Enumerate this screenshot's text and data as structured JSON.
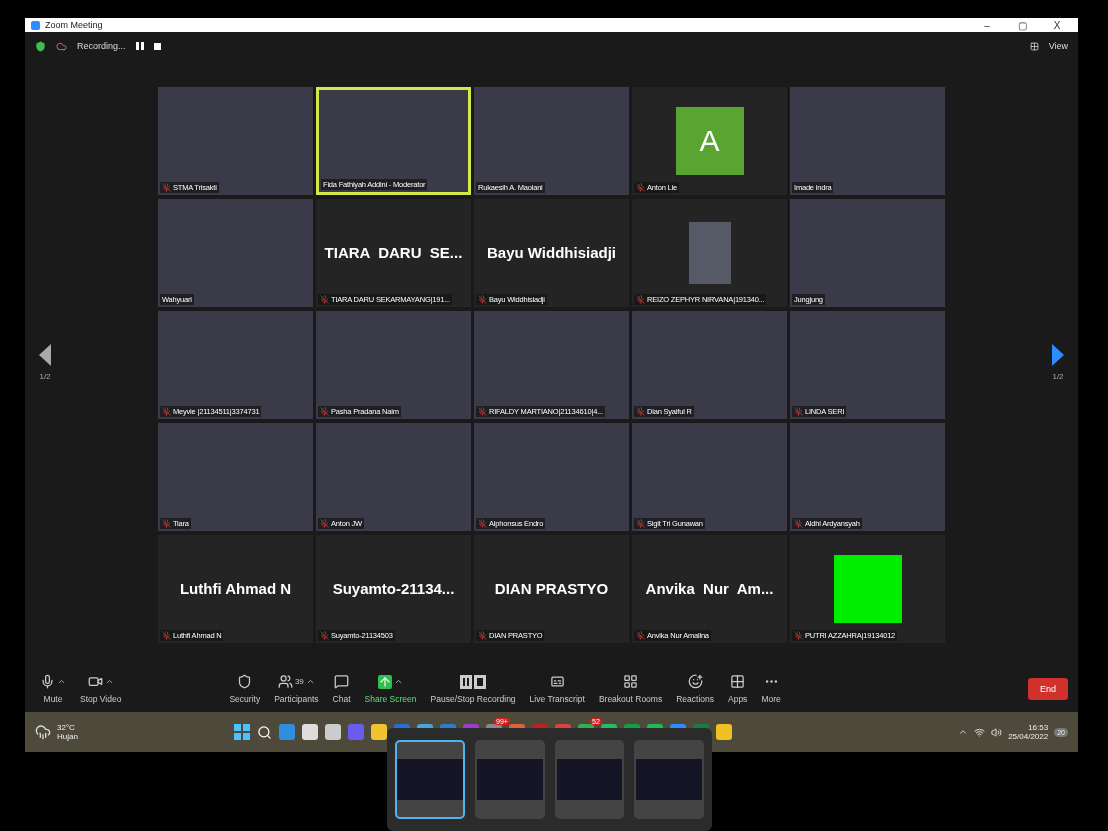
{
  "window": {
    "title": "Zoom Meeting",
    "controls": [
      "–",
      "▢",
      "X"
    ]
  },
  "topbar": {
    "recording": "Recording...",
    "view": "View"
  },
  "pager": {
    "left": "1/2",
    "right": "1/2"
  },
  "tiles": [
    {
      "kind": "video",
      "name": "STMA Trisakti",
      "muted": true,
      "selected": false
    },
    {
      "kind": "video",
      "name": "Fida Fathiyah Addini - Moderator",
      "muted": false,
      "selected": true
    },
    {
      "kind": "video",
      "name": "Rukaesih A. Maolani",
      "muted": false,
      "selected": false
    },
    {
      "kind": "letter",
      "letter": "A",
      "color": "#5aa532",
      "name": "Anton Lie",
      "muted": true,
      "selected": false
    },
    {
      "kind": "video",
      "name": "Imade indra",
      "muted": false,
      "selected": false
    },
    {
      "kind": "video",
      "name": "Wahyuari",
      "muted": false,
      "selected": false
    },
    {
      "kind": "text",
      "display": "TIARA  DARU  SE...",
      "name": "TIARA DARU SEKARMAYANG|191...",
      "muted": true,
      "selected": false
    },
    {
      "kind": "text",
      "display": "Bayu Widdhisiadji",
      "name": "Bayu Widdhisiadji",
      "muted": true,
      "selected": false
    },
    {
      "kind": "image",
      "name": "REIZO ZEPHYR NIRVANA|191340...",
      "muted": true,
      "selected": false
    },
    {
      "kind": "video",
      "name": "Jungjung",
      "muted": false,
      "selected": false
    },
    {
      "kind": "video",
      "name": "Meyvie |21134511|3374731",
      "muted": true,
      "selected": false
    },
    {
      "kind": "video",
      "name": "Pasha Pradana Naim",
      "muted": true,
      "selected": false
    },
    {
      "kind": "video",
      "name": "RIFALDY MARTIANO|21134610|4...",
      "muted": true,
      "selected": false
    },
    {
      "kind": "video",
      "name": "Dian Syaiful R",
      "muted": true,
      "selected": false
    },
    {
      "kind": "video",
      "name": "LINDA SERI",
      "muted": true,
      "selected": false
    },
    {
      "kind": "video",
      "name": "Tiara",
      "muted": true,
      "selected": false
    },
    {
      "kind": "video",
      "name": "Anton JW",
      "muted": true,
      "selected": false
    },
    {
      "kind": "video",
      "name": "Alphonsus Endro",
      "muted": true,
      "selected": false
    },
    {
      "kind": "video",
      "name": "Sigit Tri Gunawan",
      "muted": true,
      "selected": false
    },
    {
      "kind": "video",
      "name": "Aldhi Ardyansyah",
      "muted": true,
      "selected": false
    },
    {
      "kind": "text",
      "display": "Luthfi Ahmad N",
      "name": "Luthfi Ahmad N",
      "muted": true,
      "selected": false
    },
    {
      "kind": "text",
      "display": "Suyamto-21134...",
      "name": "Suyamto-21134503",
      "muted": true,
      "selected": false
    },
    {
      "kind": "text",
      "display": "DIAN PRASTYO",
      "name": "DIAN PRASTYO",
      "muted": true,
      "selected": false
    },
    {
      "kind": "text",
      "display": "Anvika  Nur  Am...",
      "name": "Anvika Nur Amalina",
      "muted": true,
      "selected": false
    },
    {
      "kind": "letter",
      "color": "#00ee00",
      "name": "PUTRI AZZAHRA|19134012",
      "muted": true,
      "selected": false
    }
  ],
  "toolbar": [
    {
      "kind": "mic",
      "label": "Mute",
      "caret": true
    },
    {
      "kind": "video",
      "label": "Stop Video",
      "caret": true
    },
    {
      "kind": "spacer"
    },
    {
      "kind": "shield",
      "label": "Security",
      "caret": false
    },
    {
      "kind": "people",
      "label": "Participants",
      "count": "39",
      "caret": true
    },
    {
      "kind": "chat",
      "label": "Chat",
      "caret": false
    },
    {
      "kind": "share",
      "label": "Share Screen",
      "caret": true
    },
    {
      "kind": "record",
      "label": "Pause/Stop Recording",
      "caret": false
    },
    {
      "kind": "cc",
      "label": "Live Transcript",
      "caret": false
    },
    {
      "kind": "rooms",
      "label": "Breakout Rooms",
      "caret": false
    },
    {
      "kind": "react",
      "label": "Reactions",
      "caret": false
    },
    {
      "kind": "apps",
      "label": "Apps",
      "caret": false
    },
    {
      "kind": "more",
      "label": "More",
      "caret": false
    }
  ],
  "end_button": "End",
  "taskbar": {
    "temperature": "32°C",
    "weather": "Hujan",
    "time": "16:53",
    "date": "25/04/2022",
    "notifications": "20",
    "apps": [
      {
        "color": "#2e8fe0"
      },
      {
        "color": "#dddddd"
      },
      {
        "color": "#cccccc"
      },
      {
        "color": "#6a5cf0"
      },
      {
        "color": "#f2c230"
      },
      {
        "color": "#2a6fd0"
      },
      {
        "color": "#49a3e0"
      },
      {
        "color": "#2a7fd0"
      },
      {
        "color": "#9a3cd0"
      },
      {
        "color": "#888888",
        "badge": "99+"
      },
      {
        "color": "#e06040"
      },
      {
        "color": "#c02020"
      },
      {
        "color": "#e04040"
      },
      {
        "color": "#30b050",
        "badge": "52"
      },
      {
        "color": "#20c060"
      },
      {
        "color": "#10a040"
      },
      {
        "color": "#1db954"
      },
      {
        "color": "#2d8cff"
      },
      {
        "color": "#1d7a40"
      },
      {
        "color": "#f0c020"
      }
    ]
  },
  "switcher": [
    {
      "selected": true
    },
    {
      "selected": false
    },
    {
      "selected": false
    },
    {
      "selected": false
    }
  ]
}
